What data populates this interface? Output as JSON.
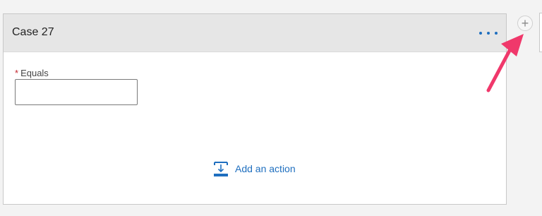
{
  "case_card": {
    "title": "Case 27",
    "more_options_icon": "ellipsis-icon",
    "equals_field": {
      "label": "Equals",
      "required_marker": "*",
      "value": "",
      "placeholder": ""
    },
    "add_action": {
      "label": "Add an action",
      "icon": "add-action-icon"
    }
  },
  "add_case_button": {
    "label": "+"
  },
  "colors": {
    "accent": "#1f6fbf",
    "required": "#c4262e",
    "annotation_arrow": "#f0386b",
    "header_bg": "#e6e6e6"
  }
}
